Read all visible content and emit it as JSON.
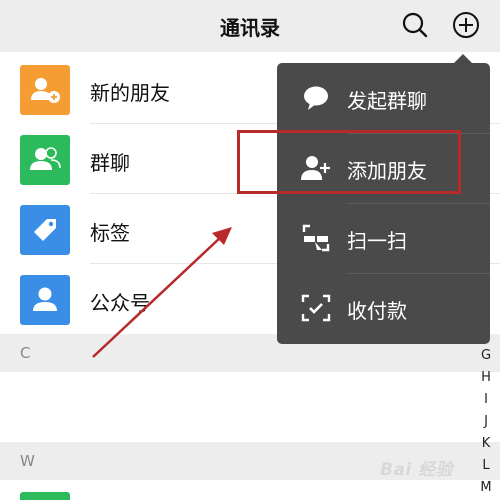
{
  "header": {
    "title": "通讯录"
  },
  "contacts": {
    "items": [
      {
        "label": "新的朋友",
        "icon": "add-friend-icon",
        "color": "#f59c33"
      },
      {
        "label": "群聊",
        "icon": "group-chat-icon",
        "color": "#2bbb5c"
      },
      {
        "label": "标签",
        "icon": "tag-icon",
        "color": "#3a8ee6"
      },
      {
        "label": "公众号",
        "icon": "official-account-icon",
        "color": "#3a8ee6"
      }
    ]
  },
  "sections": [
    {
      "letter": "C"
    },
    {
      "letter": "W"
    }
  ],
  "index": {
    "letters": [
      "G",
      "H",
      "I",
      "J",
      "K",
      "L",
      "M"
    ]
  },
  "popup_menu": {
    "items": [
      {
        "label": "发起群聊",
        "icon": "chat-bubble-icon"
      },
      {
        "label": "添加朋友",
        "icon": "add-friend-icon"
      },
      {
        "label": "扫一扫",
        "icon": "scan-icon"
      },
      {
        "label": "收付款",
        "icon": "payment-icon"
      }
    ]
  },
  "annotation": {
    "highlight_color": "#b72a2a"
  },
  "watermark": {
    "text": "Bai 经验"
  }
}
